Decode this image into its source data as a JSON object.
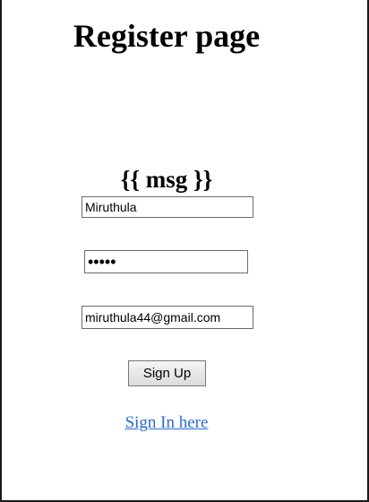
{
  "page": {
    "title": "Register page",
    "message": "{{ msg }}"
  },
  "form": {
    "username_value": "Miruthula",
    "password_value": "•••••",
    "email_value": "miruthula44@gmail.com",
    "submit_label": "Sign Up"
  },
  "footer": {
    "signin_link": "Sign In here"
  },
  "colors": {
    "link": "#2a6ad6",
    "background": "#ffffff"
  }
}
